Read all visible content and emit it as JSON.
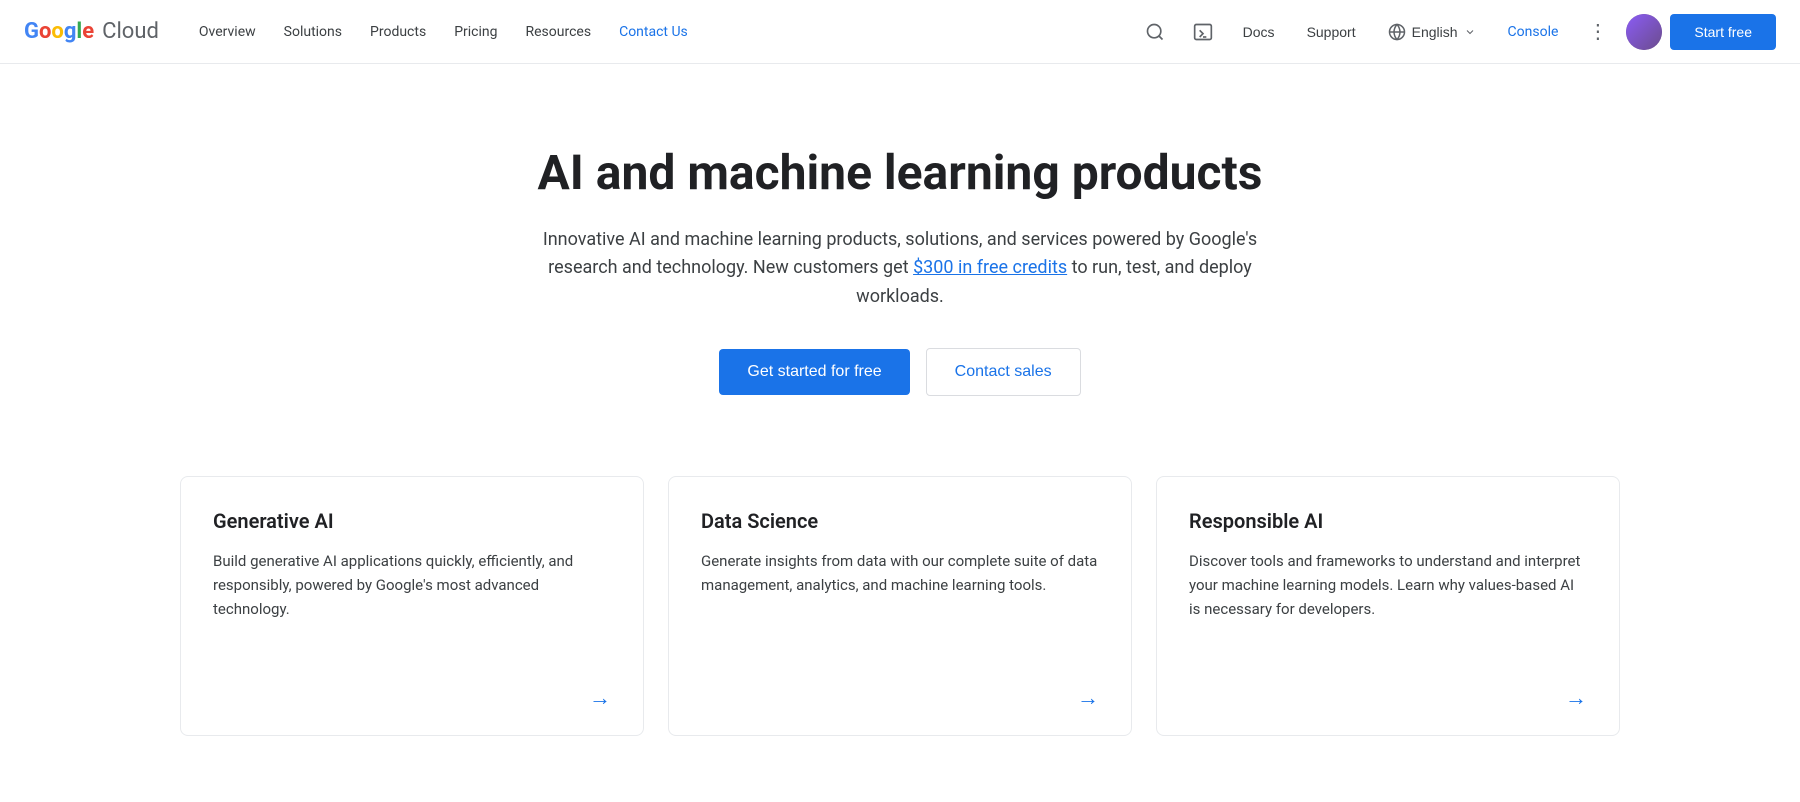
{
  "nav": {
    "logo_google": "Google",
    "logo_cloud": "Cloud",
    "links": [
      {
        "label": "Overview",
        "active": false
      },
      {
        "label": "Solutions",
        "active": false
      },
      {
        "label": "Products",
        "active": false
      },
      {
        "label": "Pricing",
        "active": false
      },
      {
        "label": "Resources",
        "active": false
      },
      {
        "label": "Contact Us",
        "active": true
      }
    ],
    "docs_label": "Docs",
    "support_label": "Support",
    "language_label": "English",
    "console_label": "Console",
    "start_free_label": "Start free",
    "more_options_label": "⋮"
  },
  "hero": {
    "title": "AI and machine learning products",
    "description_before": "Innovative AI and machine learning products, solutions, and services powered by Google's research and technology. New customers get ",
    "credits_link": "$300 in free credits",
    "description_after": " to run, test, and deploy workloads.",
    "cta_primary": "Get started for free",
    "cta_secondary": "Contact sales"
  },
  "cards": [
    {
      "title": "Generative AI",
      "description": "Build generative AI applications quickly, efficiently, and responsibly, powered by Google's most advanced technology.",
      "arrow": "→"
    },
    {
      "title": "Data Science",
      "description": "Generate insights from data with our complete suite of data management, analytics, and machine learning tools.",
      "arrow": "→"
    },
    {
      "title": "Responsible AI",
      "description": "Discover tools and frameworks to understand and interpret your machine learning models. Learn why values-based AI is necessary for developers.",
      "arrow": "→"
    }
  ]
}
